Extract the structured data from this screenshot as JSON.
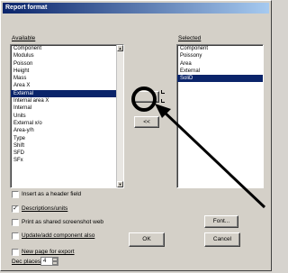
{
  "window": {
    "title": "Report format"
  },
  "available": {
    "label": "Available",
    "items": [
      "Component",
      "Modulus",
      "Poisson",
      "Height",
      "Mass",
      "Area X",
      "External",
      "Internal area X",
      "Internal",
      "Units",
      "External x/o",
      "Area-y/h",
      "Type",
      "Shift",
      "SFD",
      "SFx"
    ],
    "selected_index": 6
  },
  "selected": {
    "label": "Selected",
    "items": [
      "Component",
      "Poissony",
      "Area",
      "External",
      "SoliD"
    ],
    "selected_index": 4
  },
  "buttons": {
    "add": "",
    "remove": "<<",
    "font": "Font...",
    "ok": "OK",
    "cancel": "Cancel"
  },
  "options": {
    "insert_header": "Insert as a header field",
    "descriptions": "Descriptions/units",
    "print_shape": "Print as shared screenshot web",
    "update_components": "Update/add component also",
    "new_page": "New page for export",
    "dec_places_label": "Dec places",
    "dec_places_value": "4"
  },
  "colors": {
    "accent": "#0a246a",
    "title_gradient_end": "#a6caf0"
  }
}
